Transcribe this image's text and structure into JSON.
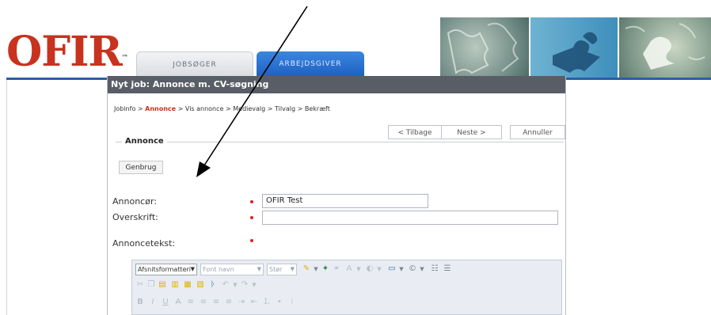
{
  "header": {
    "logo_text": "OFIR",
    "logo_tm": "™",
    "tabs": [
      {
        "label": "JOBSØGER"
      },
      {
        "label": "ARBEJDSGIVER"
      }
    ]
  },
  "panel": {
    "title": "Nyt job: Annonce m. CV-søgning",
    "breadcrumb": {
      "items": [
        "Jobinfo",
        "Annonce",
        "Vis annonce",
        "Medievalg",
        "Tilvalg",
        "Bekræft"
      ],
      "separator": ">",
      "active_index": 1
    },
    "nav": {
      "back_label": "< Tilbage",
      "next_label": "Neste >",
      "cancel_label": "Annuller"
    },
    "section_legend": "Annonce",
    "genbrug_label": "Genbrug",
    "fields": {
      "annoncor_label": "Annoncør:",
      "annoncor_value": "OFIR Test",
      "overskrift_label": "Overskrift:",
      "overskrift_value": "",
      "annoncetekst_label": "Annoncetekst:"
    },
    "editor": {
      "format_select": "Afsnitsformatteri",
      "font_select": "Font navn",
      "size_select": "Stør"
    }
  },
  "colors": {
    "brand_red": "#c8321e",
    "brand_blue": "#2a5ea8",
    "panel_header": "#595e66",
    "required": "#dd2222"
  }
}
